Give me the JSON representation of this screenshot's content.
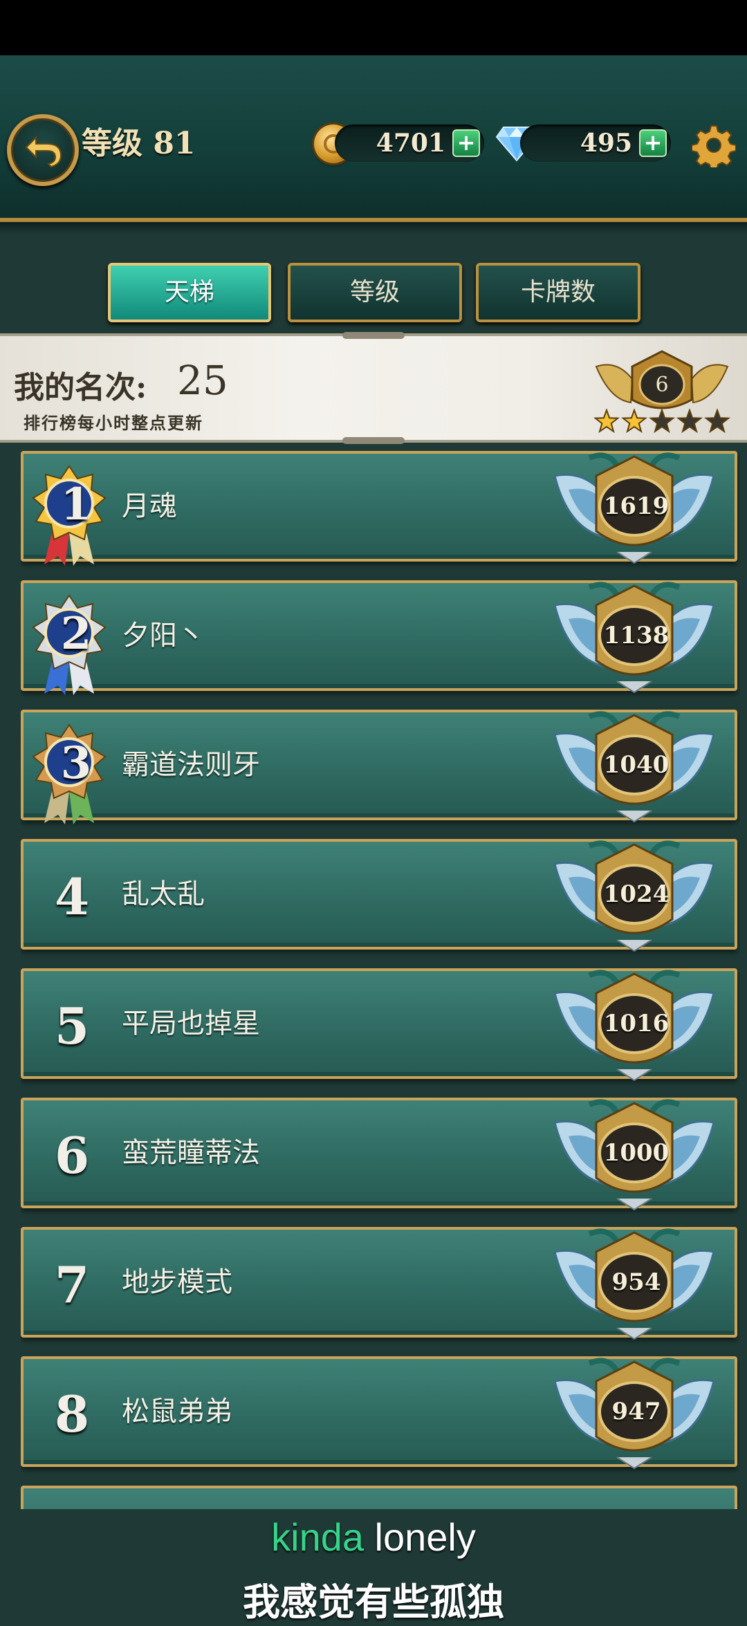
{
  "header": {
    "level_label": "等级 81",
    "gold": "4701",
    "diamonds": "495",
    "plus": "+"
  },
  "tabs": [
    {
      "label": "天梯",
      "active": true
    },
    {
      "label": "等级",
      "active": false
    },
    {
      "label": "卡牌数",
      "active": false
    }
  ],
  "my_rank": {
    "label": "我的名次:",
    "value": "25",
    "note": "排行榜每小时整点更新",
    "badge_level": "6",
    "stars_filled": 2,
    "stars_total": 5
  },
  "leaderboard": [
    {
      "rank": "1",
      "name": "月魂",
      "score": "1619",
      "medal": "gold"
    },
    {
      "rank": "2",
      "name": "夕阳丶",
      "score": "1138",
      "medal": "silver"
    },
    {
      "rank": "3",
      "name": "霸道法则牙",
      "score": "1040",
      "medal": "bronze"
    },
    {
      "rank": "4",
      "name": "乱太乱",
      "score": "1024",
      "medal": ""
    },
    {
      "rank": "5",
      "name": "平局也掉星",
      "score": "1016",
      "medal": ""
    },
    {
      "rank": "6",
      "name": "蛮荒瞳蒂法",
      "score": "1000",
      "medal": ""
    },
    {
      "rank": "7",
      "name": "地步模式",
      "score": "954",
      "medal": ""
    },
    {
      "rank": "8",
      "name": "松鼠弟弟",
      "score": "947",
      "medal": ""
    }
  ],
  "subtitle": {
    "highlight": "kinda",
    "rest": " lonely",
    "zh": "我感觉有些孤独"
  },
  "colors": {
    "accent_teal": "#12897a",
    "gold_border": "#c9a45a",
    "row_green": "#2f6b62",
    "subtitle_highlight": "#36d48a"
  },
  "icons": [
    "back-arrow-icon",
    "coin-icon",
    "diamond-icon",
    "gear-icon",
    "rank-medal-icon",
    "ladder-crest-icon",
    "star-icon"
  ]
}
